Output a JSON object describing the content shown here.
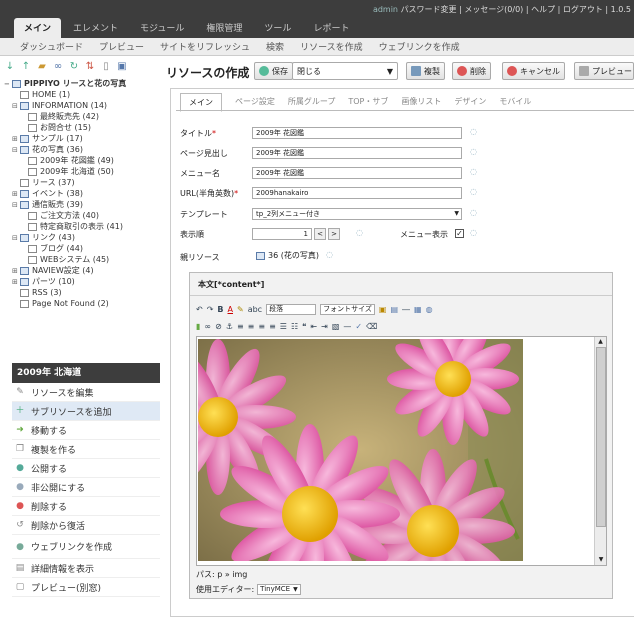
{
  "header": {
    "user": "admin",
    "links": "パスワード変更 | メッセージ(0/0) | ヘルプ | ログアウト | 1.0.5",
    "tabs": [
      "メイン",
      "エレメント",
      "モジュール",
      "権限管理",
      "ツール",
      "レポート"
    ]
  },
  "subnav": [
    "ダッシュボード",
    "プレビュー",
    "サイトをリフレッシュ",
    "検索",
    "リソースを作成",
    "ウェブリンクを作成"
  ],
  "tree_tools": [
    "arrow-down-icon",
    "arrow-up-icon",
    "folder-new-icon",
    "link-icon",
    "refresh-icon",
    "sort-icon",
    "trash-icon",
    "view-icon"
  ],
  "tree": [
    {
      "label": "PIPPIYO リースと花の写真",
      "level": 0,
      "toggle": "−",
      "kind": "root"
    },
    {
      "label": "HOME (1)",
      "level": 1,
      "toggle": "",
      "kind": "page"
    },
    {
      "label": "INFORMATION (14)",
      "level": 1,
      "toggle": "⊟",
      "kind": "folder"
    },
    {
      "label": "最終販売先 (42)",
      "level": 2,
      "toggle": "",
      "kind": "page"
    },
    {
      "label": "お問合せ (15)",
      "level": 2,
      "toggle": "",
      "kind": "page"
    },
    {
      "label": "サンプル (17)",
      "level": 1,
      "toggle": "⊞",
      "kind": "folder"
    },
    {
      "label": "花の写真 (36)",
      "level": 1,
      "toggle": "⊟",
      "kind": "folder"
    },
    {
      "label": "2009年 花図鑑 (49)",
      "level": 2,
      "toggle": "",
      "kind": "page"
    },
    {
      "label": "2009年 北海道 (50)",
      "level": 2,
      "toggle": "",
      "kind": "page"
    },
    {
      "label": "リース (37)",
      "level": 1,
      "toggle": "",
      "kind": "page"
    },
    {
      "label": "イベント (38)",
      "level": 1,
      "toggle": "⊞",
      "kind": "folder"
    },
    {
      "label": "通信販売 (39)",
      "level": 1,
      "toggle": "⊟",
      "kind": "folder"
    },
    {
      "label": "ご注文方法 (40)",
      "level": 2,
      "toggle": "",
      "kind": "page"
    },
    {
      "label": "特定商取引の表示 (41)",
      "level": 2,
      "toggle": "",
      "kind": "page"
    },
    {
      "label": "リンク (43)",
      "level": 1,
      "toggle": "⊟",
      "kind": "folder"
    },
    {
      "label": "ブログ (44)",
      "level": 2,
      "toggle": "",
      "kind": "page"
    },
    {
      "label": "WEBシステム (45)",
      "level": 2,
      "toggle": "",
      "kind": "page"
    },
    {
      "label": "NAVIEW設定 (4)",
      "level": 1,
      "toggle": "⊞",
      "kind": "folder"
    },
    {
      "label": "パーツ (10)",
      "level": 1,
      "toggle": "⊞",
      "kind": "folder"
    },
    {
      "label": "RSS (3)",
      "level": 1,
      "toggle": "",
      "kind": "page"
    },
    {
      "label": "Page Not Found (2)",
      "level": 1,
      "toggle": "",
      "kind": "page"
    }
  ],
  "context": {
    "title": "2009年 北海道",
    "items": [
      {
        "label": "リソースを編集",
        "icon": "pencil-icon",
        "glyph": "✎",
        "color": "#888"
      },
      {
        "label": "サブリソースを追加",
        "icon": "add-page-icon",
        "glyph": "＋",
        "color": "#4a7"
      },
      {
        "label": "移動する",
        "icon": "move-icon",
        "glyph": "➜",
        "color": "#6a4"
      },
      {
        "label": "複製を作る",
        "icon": "copy-icon",
        "glyph": "❐",
        "color": "#888"
      },
      {
        "label": "公開する",
        "icon": "publish-icon",
        "glyph": "●",
        "color": "#5a9"
      },
      {
        "label": "非公開にする",
        "icon": "unpublish-icon",
        "glyph": "●",
        "color": "#9ab"
      },
      {
        "label": "削除する",
        "icon": "delete-icon",
        "glyph": "●",
        "color": "#d55"
      },
      {
        "label": "削除から復活",
        "icon": "restore-icon",
        "glyph": "↺",
        "color": "#888"
      },
      {
        "label": "ウェブリンクを作成",
        "icon": "weblink-icon",
        "glyph": "●",
        "color": "#7a9"
      },
      {
        "label": "詳細情報を表示",
        "icon": "info-icon",
        "glyph": "▤",
        "color": "#888"
      },
      {
        "label": "プレビュー(別窓)",
        "icon": "preview-icon",
        "glyph": "▢",
        "color": "#888"
      }
    ]
  },
  "main": {
    "title": "リソースの作成",
    "save": "保存",
    "close_select": "閉じる",
    "duplicate": "複製",
    "delete": "削除",
    "cancel": "キャンセル",
    "preview": "プレビュー",
    "tabs": [
      "メイン",
      "ページ設定",
      "所属グループ",
      "TOP・サブ",
      "画像リスト",
      "デザイン",
      "モバイル"
    ],
    "fields": {
      "title_label": "タイトル",
      "title_value": "2009年 花図鑑",
      "longtitle_label": "ページ見出し",
      "longtitle_value": "2009年 花図鑑",
      "menu_label": "メニュー名",
      "menu_value": "2009年 花図鑑",
      "alias_label": "URL(半角英数)",
      "alias_value": "2009hanakairo",
      "template_label": "テンプレート",
      "template_value": "tp_2列メニュー付き",
      "order_label": "表示順",
      "order_value": "1",
      "menu_show_label": "メニュー表示",
      "parent_label": "親リソース",
      "parent_value": "36 (花の写真)"
    },
    "editor": {
      "label": "本文[*content*]",
      "format": "段落",
      "fontsize": "フォントサイズ",
      "path": "パス: p » img",
      "editor_label": "使用エディター:",
      "editor_value": "TinyMCE"
    }
  },
  "colors": {
    "header": "#3d3d3d",
    "accent": "#5a7ba8"
  }
}
